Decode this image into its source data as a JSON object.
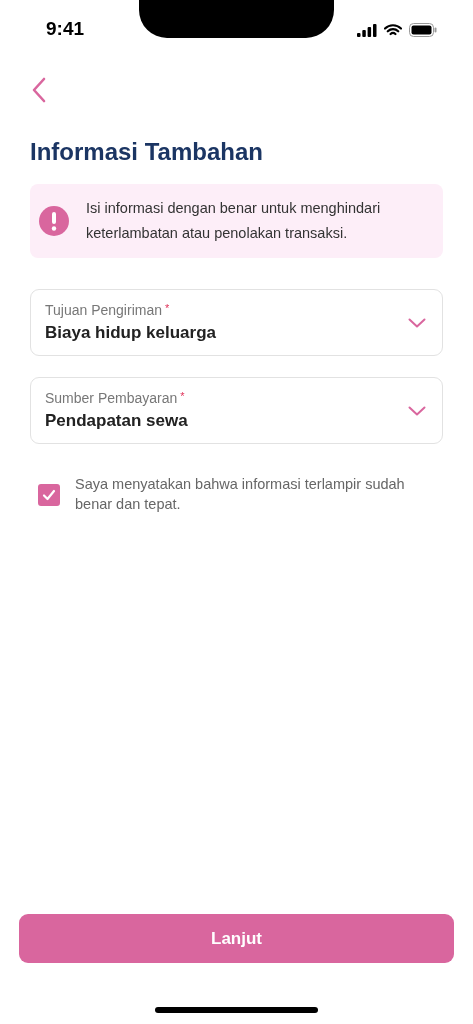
{
  "status_bar": {
    "time": "9:41"
  },
  "title": "Informasi Tambahan",
  "alert": {
    "message": "Isi informasi dengan benar untuk menghindari keterlambatan atau penolakan transaksi."
  },
  "fields": [
    {
      "label": "Tujuan Pengiriman",
      "required_mark": "*",
      "value": "Biaya hidup keluarga"
    },
    {
      "label": "Sumber Pembayaran",
      "required_mark": "*",
      "value": "Pendapatan sewa"
    }
  ],
  "consent": {
    "text": "Saya menyatakan bahwa informasi terlampir sudah benar dan tepat.",
    "checked": true
  },
  "primary_button": {
    "label": "Lanjut"
  }
}
